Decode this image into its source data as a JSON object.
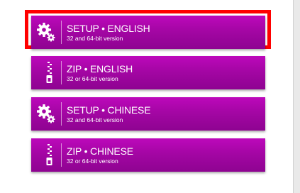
{
  "downloads": [
    {
      "title": "SETUP • ENGLISH",
      "subtitle": "32 and 64-bit version",
      "icon": "gears-icon"
    },
    {
      "title": "ZIP • ENGLISH",
      "subtitle": "32 or 64-bit version",
      "icon": "zip-file-icon"
    },
    {
      "title": "SETUP • CHINESE",
      "subtitle": "32 and 64-bit version",
      "icon": "gears-icon"
    },
    {
      "title": "ZIP • CHINESE",
      "subtitle": "32 or 64-bit version",
      "icon": "zip-file-icon"
    }
  ],
  "colors": {
    "button_top": "#bd08bb",
    "button_bottom": "#8e0391",
    "focus_ring": "#ff0000"
  }
}
